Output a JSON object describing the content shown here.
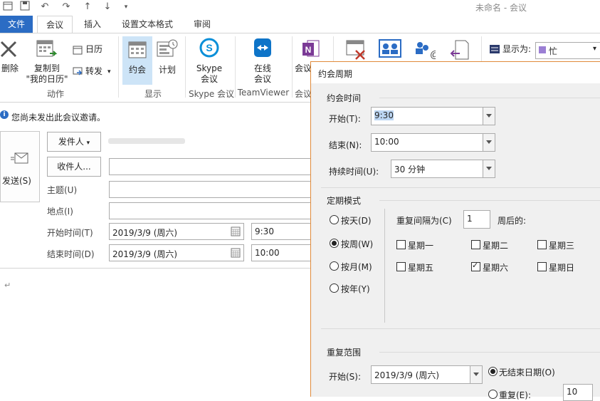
{
  "window": {
    "title": "未命名 - 会议"
  },
  "quick_access": {
    "icons": [
      "calendar-icon",
      "save-icon",
      "undo-icon",
      "redo-icon",
      "up-icon",
      "down-icon",
      "dropdown-icon"
    ]
  },
  "tabs": [
    {
      "label": "文件"
    },
    {
      "label": "会议"
    },
    {
      "label": "插入"
    },
    {
      "label": "设置文本格式"
    },
    {
      "label": "审阅"
    }
  ],
  "ribbon": {
    "delete_label": "删除",
    "copy_to_line1": "复制到",
    "copy_to_line2": "\"我的日历\"",
    "calendar_label": "日历",
    "forward_label": "转发",
    "actions_group": "动作",
    "appointment_label": "约会",
    "schedule_label": "计划",
    "display_group": "显示",
    "skype_line1": "Skype",
    "skype_line2": "会议",
    "skype_group": "Skype 会议",
    "online_line1": "在线",
    "online_line2": "会议",
    "teamviewer_group": "TeamViewer",
    "meeting_label": "会议",
    "meeting_group": "会议",
    "show_as_label": "显示为:",
    "show_as_value": "忙",
    "show_as_color": "#9b7fd4"
  },
  "compose": {
    "info_text": "您尚未发出此会议邀请。",
    "send_label": "发送(S)",
    "from_label": "发件人",
    "to_label": "收件人...",
    "subject_label": "主题(U)",
    "location_label": "地点(I)",
    "start_label": "开始时间(T)",
    "end_label": "结束时间(D)",
    "start_date": "2019/3/9 (周六)",
    "start_time": "9:30",
    "end_date": "2019/3/9 (周六)",
    "end_time": "10:00",
    "body_mark": "↵"
  },
  "dialog": {
    "title": "约会周期",
    "appointment_time_section": "约会时间",
    "start_label": "开始(T):",
    "start_value": "9:30",
    "end_label": "结束(N):",
    "end_value": "10:00",
    "duration_label": "持续时间(U):",
    "duration_value": "30 分钟",
    "pattern_section": "定期模式",
    "pattern_options": [
      "按天(D)",
      "按周(W)",
      "按月(M)",
      "按年(Y)"
    ],
    "selected_pattern": "按周(W)",
    "recur_every_label": "重复间隔为(C)",
    "recur_every_value": "1",
    "weeks_on_label": "周后的:",
    "weekdays": [
      {
        "label": "星期一",
        "checked": false
      },
      {
        "label": "星期二",
        "checked": false
      },
      {
        "label": "星期三",
        "checked": false
      },
      {
        "label": "星期五",
        "checked": false
      },
      {
        "label": "星期六",
        "checked": true
      },
      {
        "label": "星期日",
        "checked": false
      }
    ],
    "range_section": "重复范围",
    "range_start_label": "开始(S):",
    "range_start_value": "2019/3/9 (周六)",
    "no_end_label": "无结束日期(O)",
    "repeat_label": "重复(E):",
    "repeat_value": "10"
  }
}
